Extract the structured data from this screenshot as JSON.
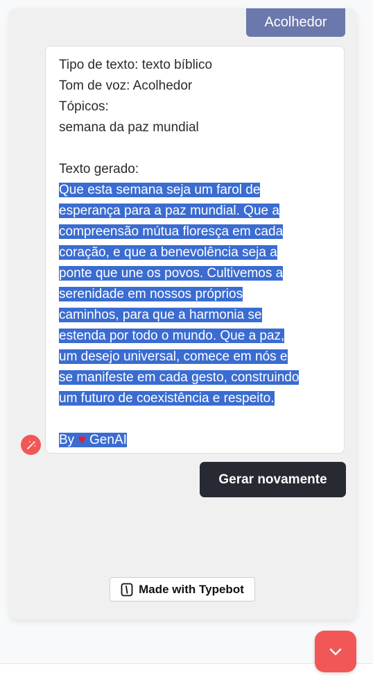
{
  "chat": {
    "user_reply": "Acolhedor",
    "bot_message": {
      "intro_lines": [
        "Tipo de texto: texto bíblico",
        "Tom de voz: Acolhedor",
        "Tópicos:",
        "semana da paz mundial",
        "",
        "Texto gerado:"
      ],
      "generated_lines": [
        "Que esta semana seja um farol de ",
        "esperança para a paz mundial. Que a ",
        "compreensão mútua floresça em cada ",
        "coração, e que a benevolência seja a ",
        "ponte que une os povos. Cultivemos a ",
        "serenidade em nossos próprios ",
        "caminhos, para que a harmonia se ",
        "estenda por todo o mundo. Que a paz, ",
        "um desejo universal, comece em nós e ",
        "se manifeste em cada gesto, construindo",
        "um futuro de coexistência e respeito. ",
        " "
      ],
      "signature": {
        "prefix": "By",
        "heart": "♥",
        "suffix": "GenAI"
      }
    }
  },
  "actions": {
    "regenerate_label": "Gerar novamente"
  },
  "branding": {
    "badge_label": "Made with Typebot"
  },
  "colors": {
    "accent": "#f25757",
    "user_bubble": "#6b78ab",
    "selection": "#3a6cd1",
    "dark_button": "#272a33"
  },
  "icons": {
    "avatar": "magic-wand-icon",
    "badge": "typebot-logo-icon",
    "fab": "chevron-down-icon"
  }
}
